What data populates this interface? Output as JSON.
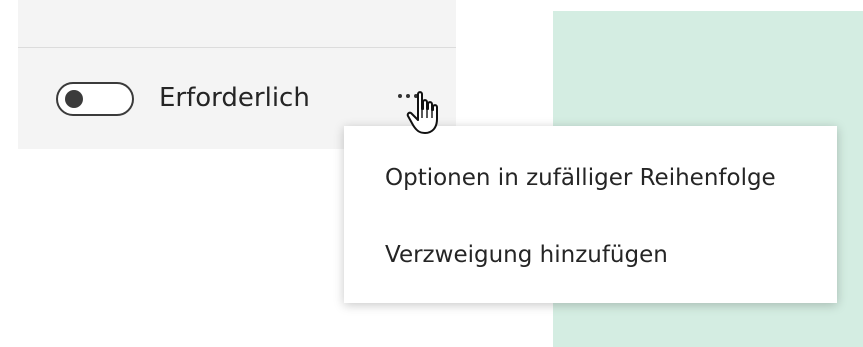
{
  "question_card": {
    "required_toggle": {
      "state": "off"
    },
    "required_label": "Erforderlich",
    "more_button": {
      "icon": "ellipsis-icon",
      "label": "•••"
    }
  },
  "dropdown_menu": {
    "items": [
      {
        "label": "Optionen in zufälliger Reihenfolge"
      },
      {
        "label": "Verzweigung hinzufügen"
      }
    ]
  },
  "colors": {
    "card_background": "#f4f4f4",
    "side_panel": "#d4ede2",
    "text": "#252525",
    "toggle": "#3b3b3b"
  },
  "cursor": {
    "icon": "hand-pointer-icon"
  }
}
